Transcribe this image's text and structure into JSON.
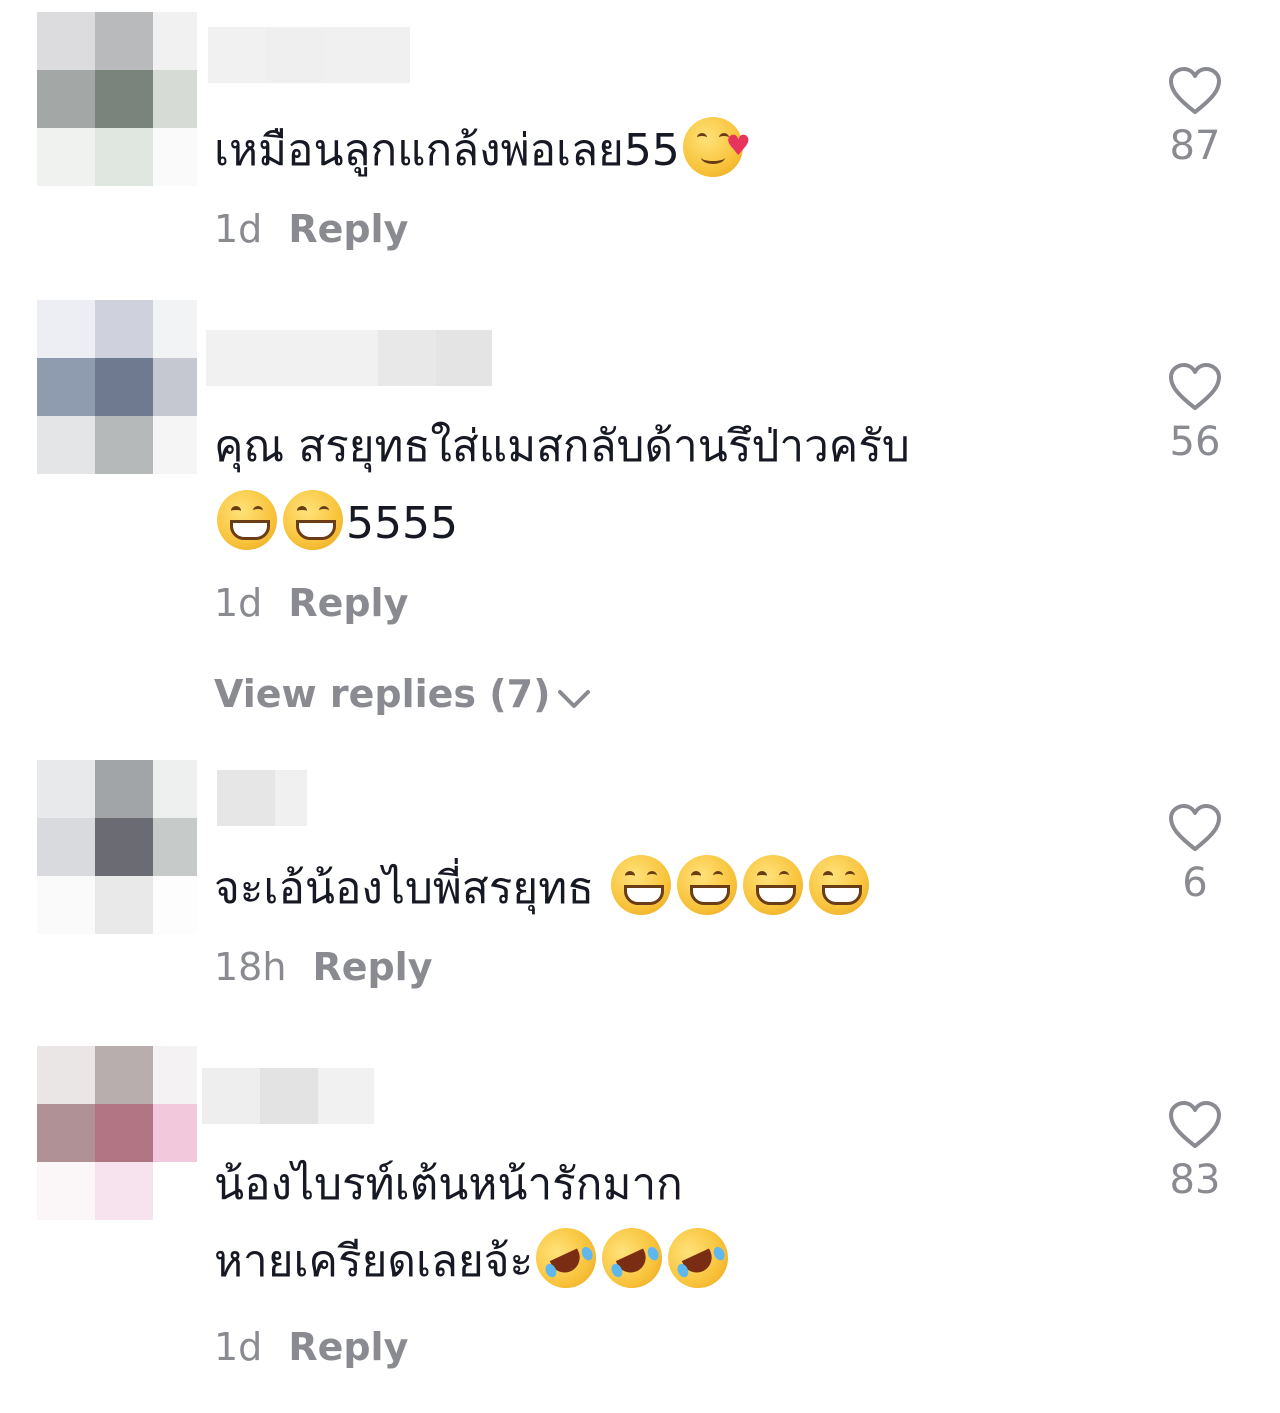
{
  "comments": [
    {
      "text": "เหมือนลูกแกล้งพ่อเลย55",
      "text2": "",
      "emojis": [
        "smiling-face-with-hearts"
      ],
      "time": "1d",
      "reply_label": "Reply",
      "likes": "87"
    },
    {
      "text": "คุณ สรยุทธใส่แมสกลับด้านรึป่าวครับ",
      "text2": "5555",
      "emojis": [
        "grinning-face",
        "grinning-face"
      ],
      "time": "1d",
      "reply_label": "Reply",
      "likes": "56",
      "view_replies": "View replies (7)"
    },
    {
      "text": "จะเอ้น้องไบพี่สรยุทธ",
      "text2": "",
      "emojis": [
        "grinning-face",
        "grinning-face",
        "grinning-face",
        "grinning-face"
      ],
      "time": "18h",
      "reply_label": "Reply",
      "likes": "6"
    },
    {
      "text": "น้องไบรท์เต้นหน้ารักมาก",
      "text2": "หายเครียดเลยจ้ะ",
      "emojis": [
        "rolling-on-floor-laughing",
        "rolling-on-floor-laughing",
        "rolling-on-floor-laughing"
      ],
      "time": "1d",
      "reply_label": "Reply",
      "likes": "83"
    }
  ],
  "colors": {
    "text": "#161823",
    "muted": "#8a8b91",
    "heart_outline": "#8a8b91"
  }
}
